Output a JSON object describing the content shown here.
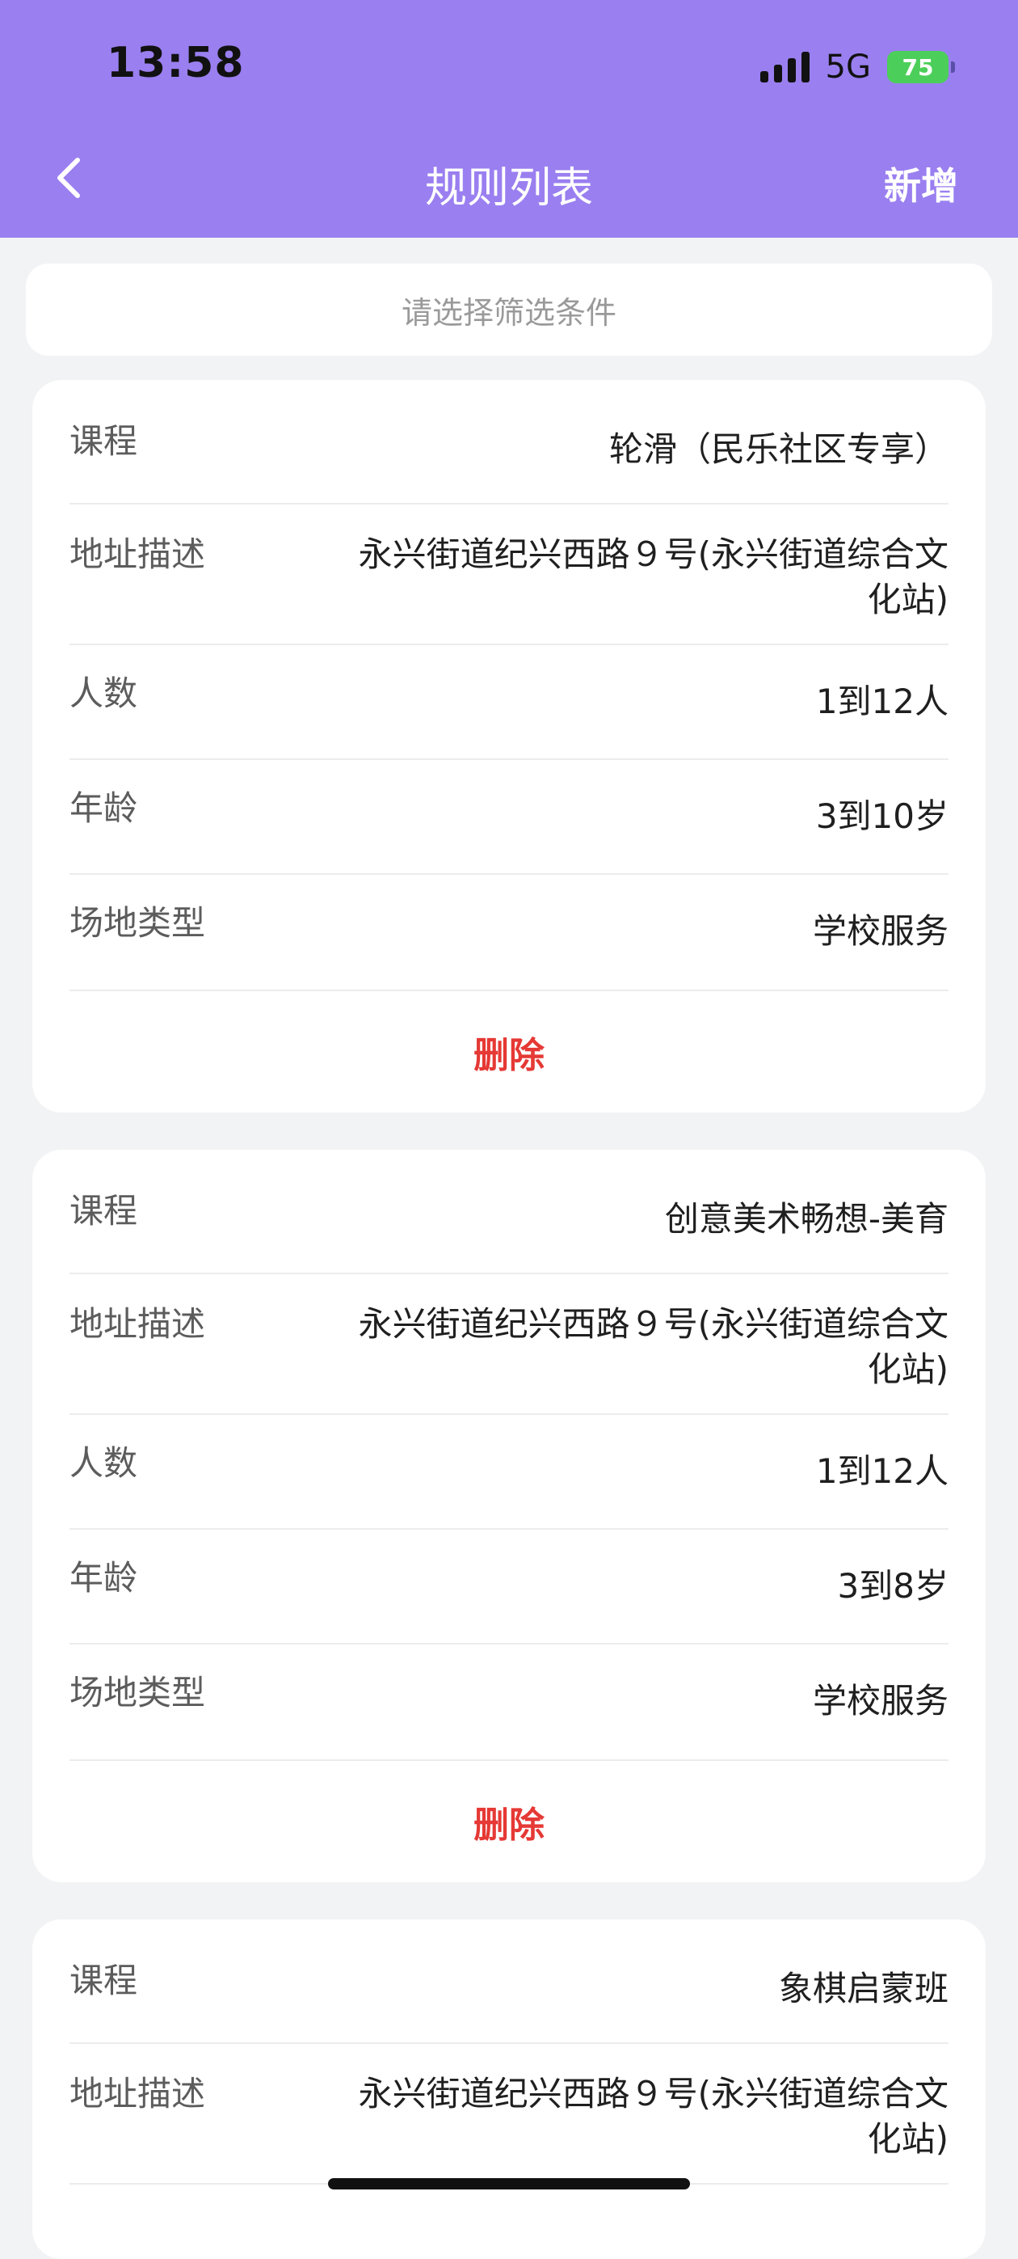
{
  "status_bar": {
    "time": "13:58",
    "network": "5G",
    "battery": "75"
  },
  "nav": {
    "title": "规则列表",
    "add_label": "新增",
    "back_icon": "chevron-left-icon"
  },
  "filter": {
    "placeholder": "请选择筛选条件"
  },
  "cards": [
    {
      "course": {
        "label": "课程",
        "value": "轮滑（民乐社区专享）"
      },
      "address": {
        "label": "地址描述",
        "value": "永兴街道纪兴西路９号(永兴街道综合文化站)"
      },
      "people": {
        "label": "人数",
        "value": "1到12人"
      },
      "age": {
        "label": "年龄",
        "value": "3到10岁"
      },
      "venue": {
        "label": "场地类型",
        "value": "学校服务"
      },
      "delete_label": "删除"
    },
    {
      "course": {
        "label": "课程",
        "value": "创意美术畅想-美育"
      },
      "address": {
        "label": "地址描述",
        "value": "永兴街道纪兴西路９号(永兴街道综合文化站)"
      },
      "people": {
        "label": "人数",
        "value": "1到12人"
      },
      "age": {
        "label": "年龄",
        "value": "3到8岁"
      },
      "venue": {
        "label": "场地类型",
        "value": "学校服务"
      },
      "delete_label": "删除"
    },
    {
      "course": {
        "label": "课程",
        "value": "象棋启蒙班"
      },
      "address": {
        "label": "地址描述",
        "value": "永兴街道纪兴西路９号(永兴街道综合文化站)"
      }
    }
  ],
  "colors": {
    "header": "#9a7ff0",
    "delete": "#e53935",
    "background": "#f2f3f5"
  }
}
